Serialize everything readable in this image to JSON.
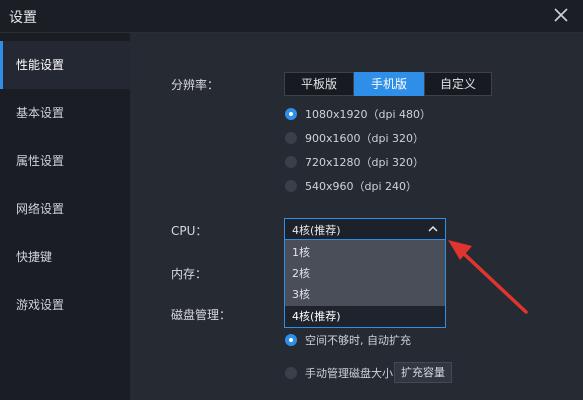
{
  "window": {
    "title": "设置"
  },
  "sidebar": {
    "items": [
      {
        "label": "性能设置",
        "active": true
      },
      {
        "label": "基本设置"
      },
      {
        "label": "属性设置"
      },
      {
        "label": "网络设置"
      },
      {
        "label": "快捷键"
      },
      {
        "label": "游戏设置"
      }
    ]
  },
  "resolution": {
    "label": "分辨率：",
    "tabs": [
      "平板版",
      "手机版",
      "自定义"
    ],
    "active_tab": "手机版",
    "options": [
      {
        "label": "1080x1920（dpi 480）",
        "checked": true
      },
      {
        "label": "900x1600（dpi 320）"
      },
      {
        "label": "720x1280（dpi 320）"
      },
      {
        "label": "540x960（dpi 240）"
      }
    ]
  },
  "cpu": {
    "label": "CPU：",
    "selected": "4核(推荐)",
    "options": [
      "1核",
      "2核",
      "3核",
      "4核(推荐)"
    ]
  },
  "memory": {
    "label": "内存："
  },
  "disk": {
    "label": "磁盘管理：",
    "options": [
      {
        "label": "空间不够时, 自动扩充",
        "checked": true
      },
      {
        "label": "手动管理磁盘大小"
      }
    ],
    "expand_button": "扩充容量"
  },
  "colors": {
    "accent": "#2f8fe8",
    "annotation": "#e0342e"
  },
  "icons": {
    "close": "close-icon",
    "dropdown": "chevron-up-icon",
    "annotation": "red-arrow-icon"
  }
}
